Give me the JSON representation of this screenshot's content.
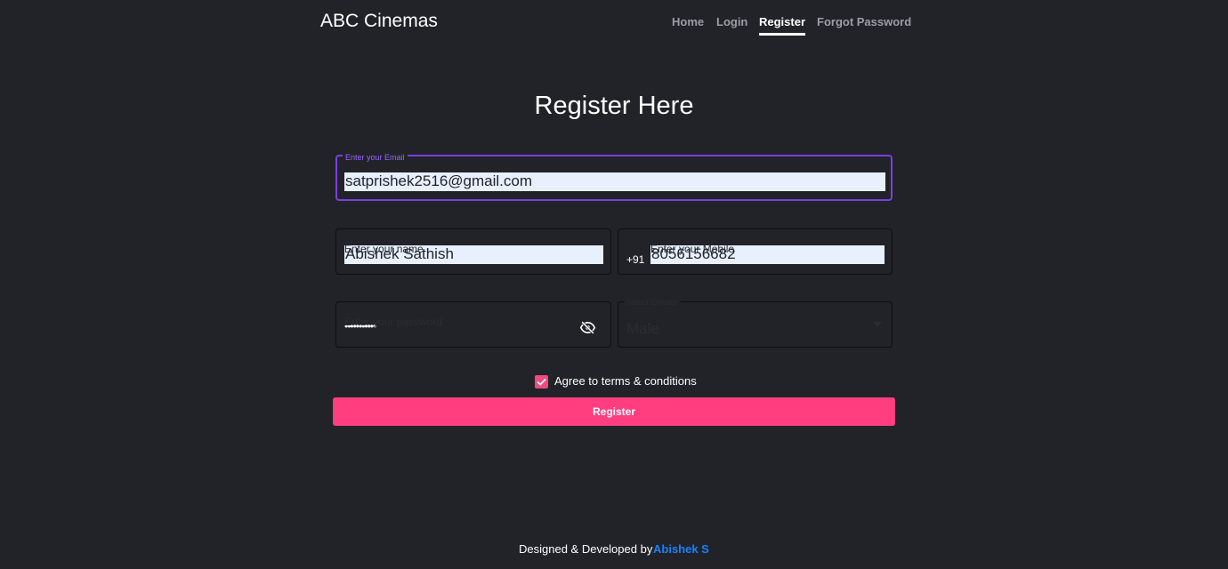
{
  "brand": "ABC Cinemas",
  "nav": {
    "home": "Home",
    "login": "Login",
    "register": "Register",
    "forgot": "Forgot Password"
  },
  "page_title": "Register Here",
  "form": {
    "email": {
      "label": "Enter your Email",
      "value": "satprishek2516@gmail.com"
    },
    "name": {
      "label": "Enter your name",
      "value": "Abishek Sathish"
    },
    "mobile": {
      "label": "Enter your Mobile",
      "prefix": "+91",
      "value": "8056156682"
    },
    "password": {
      "label": "Enter your password",
      "masked": "•••••••••••"
    },
    "gender": {
      "label": "Select Gender",
      "value": "Male"
    },
    "agree_label": "Agree to terms & conditions",
    "agree_checked": true,
    "submit_label": "Register"
  },
  "footer": {
    "text": "Designed & Developed by",
    "author": "Abishek S"
  },
  "colors": {
    "background": "#212328",
    "focus": "#7b3fe4",
    "accent": "#ff3e7f",
    "author_link": "#1b80ff",
    "autofill": "#e8f0fe"
  },
  "icons": {
    "password_toggle": "eye-off-icon",
    "agree_check": "check-icon",
    "gender_select": "caret-down-icon"
  }
}
